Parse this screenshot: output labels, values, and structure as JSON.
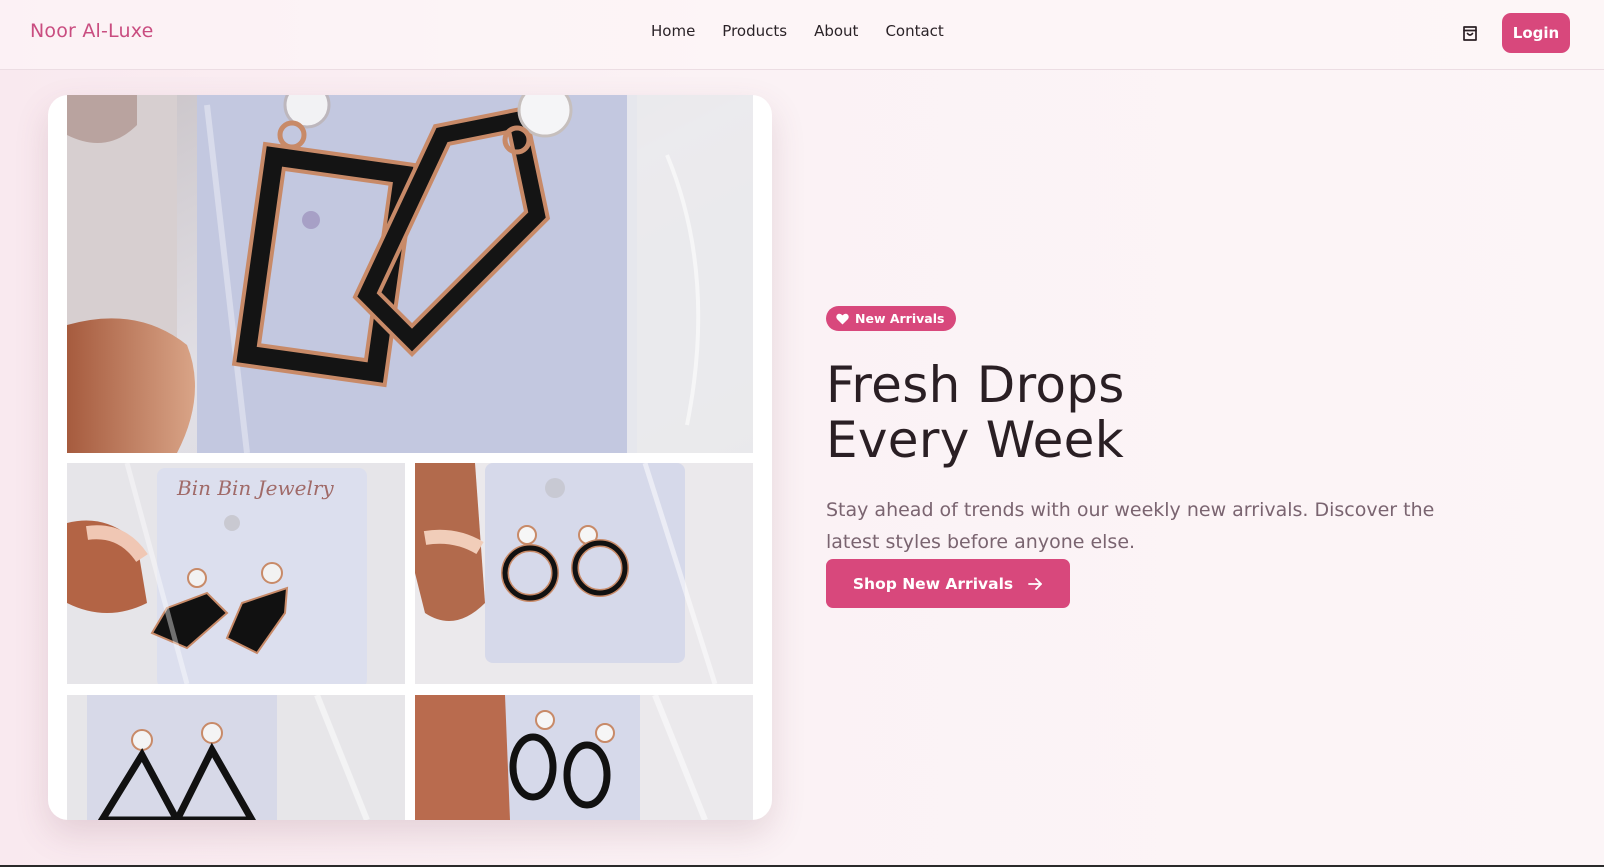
{
  "nav": {
    "brand": "Noor Al-Luxe",
    "links": [
      "Home",
      "Products",
      "About",
      "Contact"
    ],
    "cart_icon": "shopping-bag-icon",
    "login_label": "Login"
  },
  "hero": {
    "badge": "New Arrivals",
    "badge_icon": "heart-icon",
    "headline_line1": "Fresh Drops",
    "headline_line2": "Every Week",
    "subtitle": "Stay ahead of trends with our weekly new arrivals. Discover the latest styles before anyone else.",
    "cta_label": "Shop New Arrivals",
    "cta_icon": "arrow-right-icon"
  },
  "gallery": {
    "card_label": "Bin Bin Jewelry"
  },
  "colors": {
    "accent": "#d8487c",
    "brand_text": "#c94d80",
    "heading": "#2a1f24",
    "body_text": "#7a6470"
  }
}
